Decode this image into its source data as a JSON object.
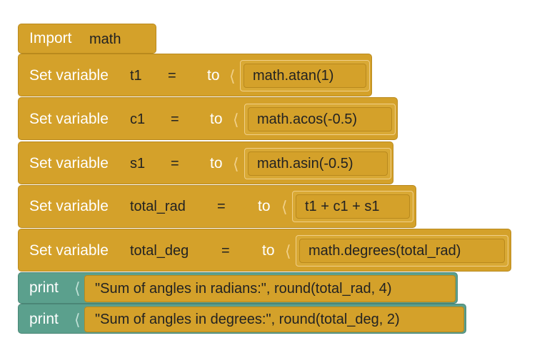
{
  "blocks": {
    "import": {
      "label": "Import",
      "module": "math"
    },
    "t1": {
      "label": "Set variable",
      "name": "t1",
      "op": "=",
      "to": "to",
      "value": "math.atan(1)"
    },
    "c1": {
      "label": "Set variable",
      "name": "c1",
      "op": "=",
      "to": "to",
      "value": "math.acos(-0.5)"
    },
    "s1": {
      "label": "Set variable",
      "name": "s1",
      "op": "=",
      "to": "to",
      "value": "math.asin(-0.5)"
    },
    "total_rad": {
      "label": "Set variable",
      "name": "total_rad",
      "op": "=",
      "to": "to",
      "value": "t1 + c1 + s1"
    },
    "total_deg": {
      "label": "Set variable",
      "name": "total_deg",
      "op": "=",
      "to": "to",
      "value": "math.degrees(total_rad)"
    },
    "print1": {
      "label": "print",
      "value": "\"Sum of angles in radians:\", round(total_rad, 4)"
    },
    "print2": {
      "label": "print",
      "value": "\"Sum of angles in degrees:\", round(total_deg, 2)"
    }
  },
  "colors": {
    "variable_block": "#d4a12a",
    "print_block": "#5ba08d",
    "field": "#f3dbb1"
  }
}
